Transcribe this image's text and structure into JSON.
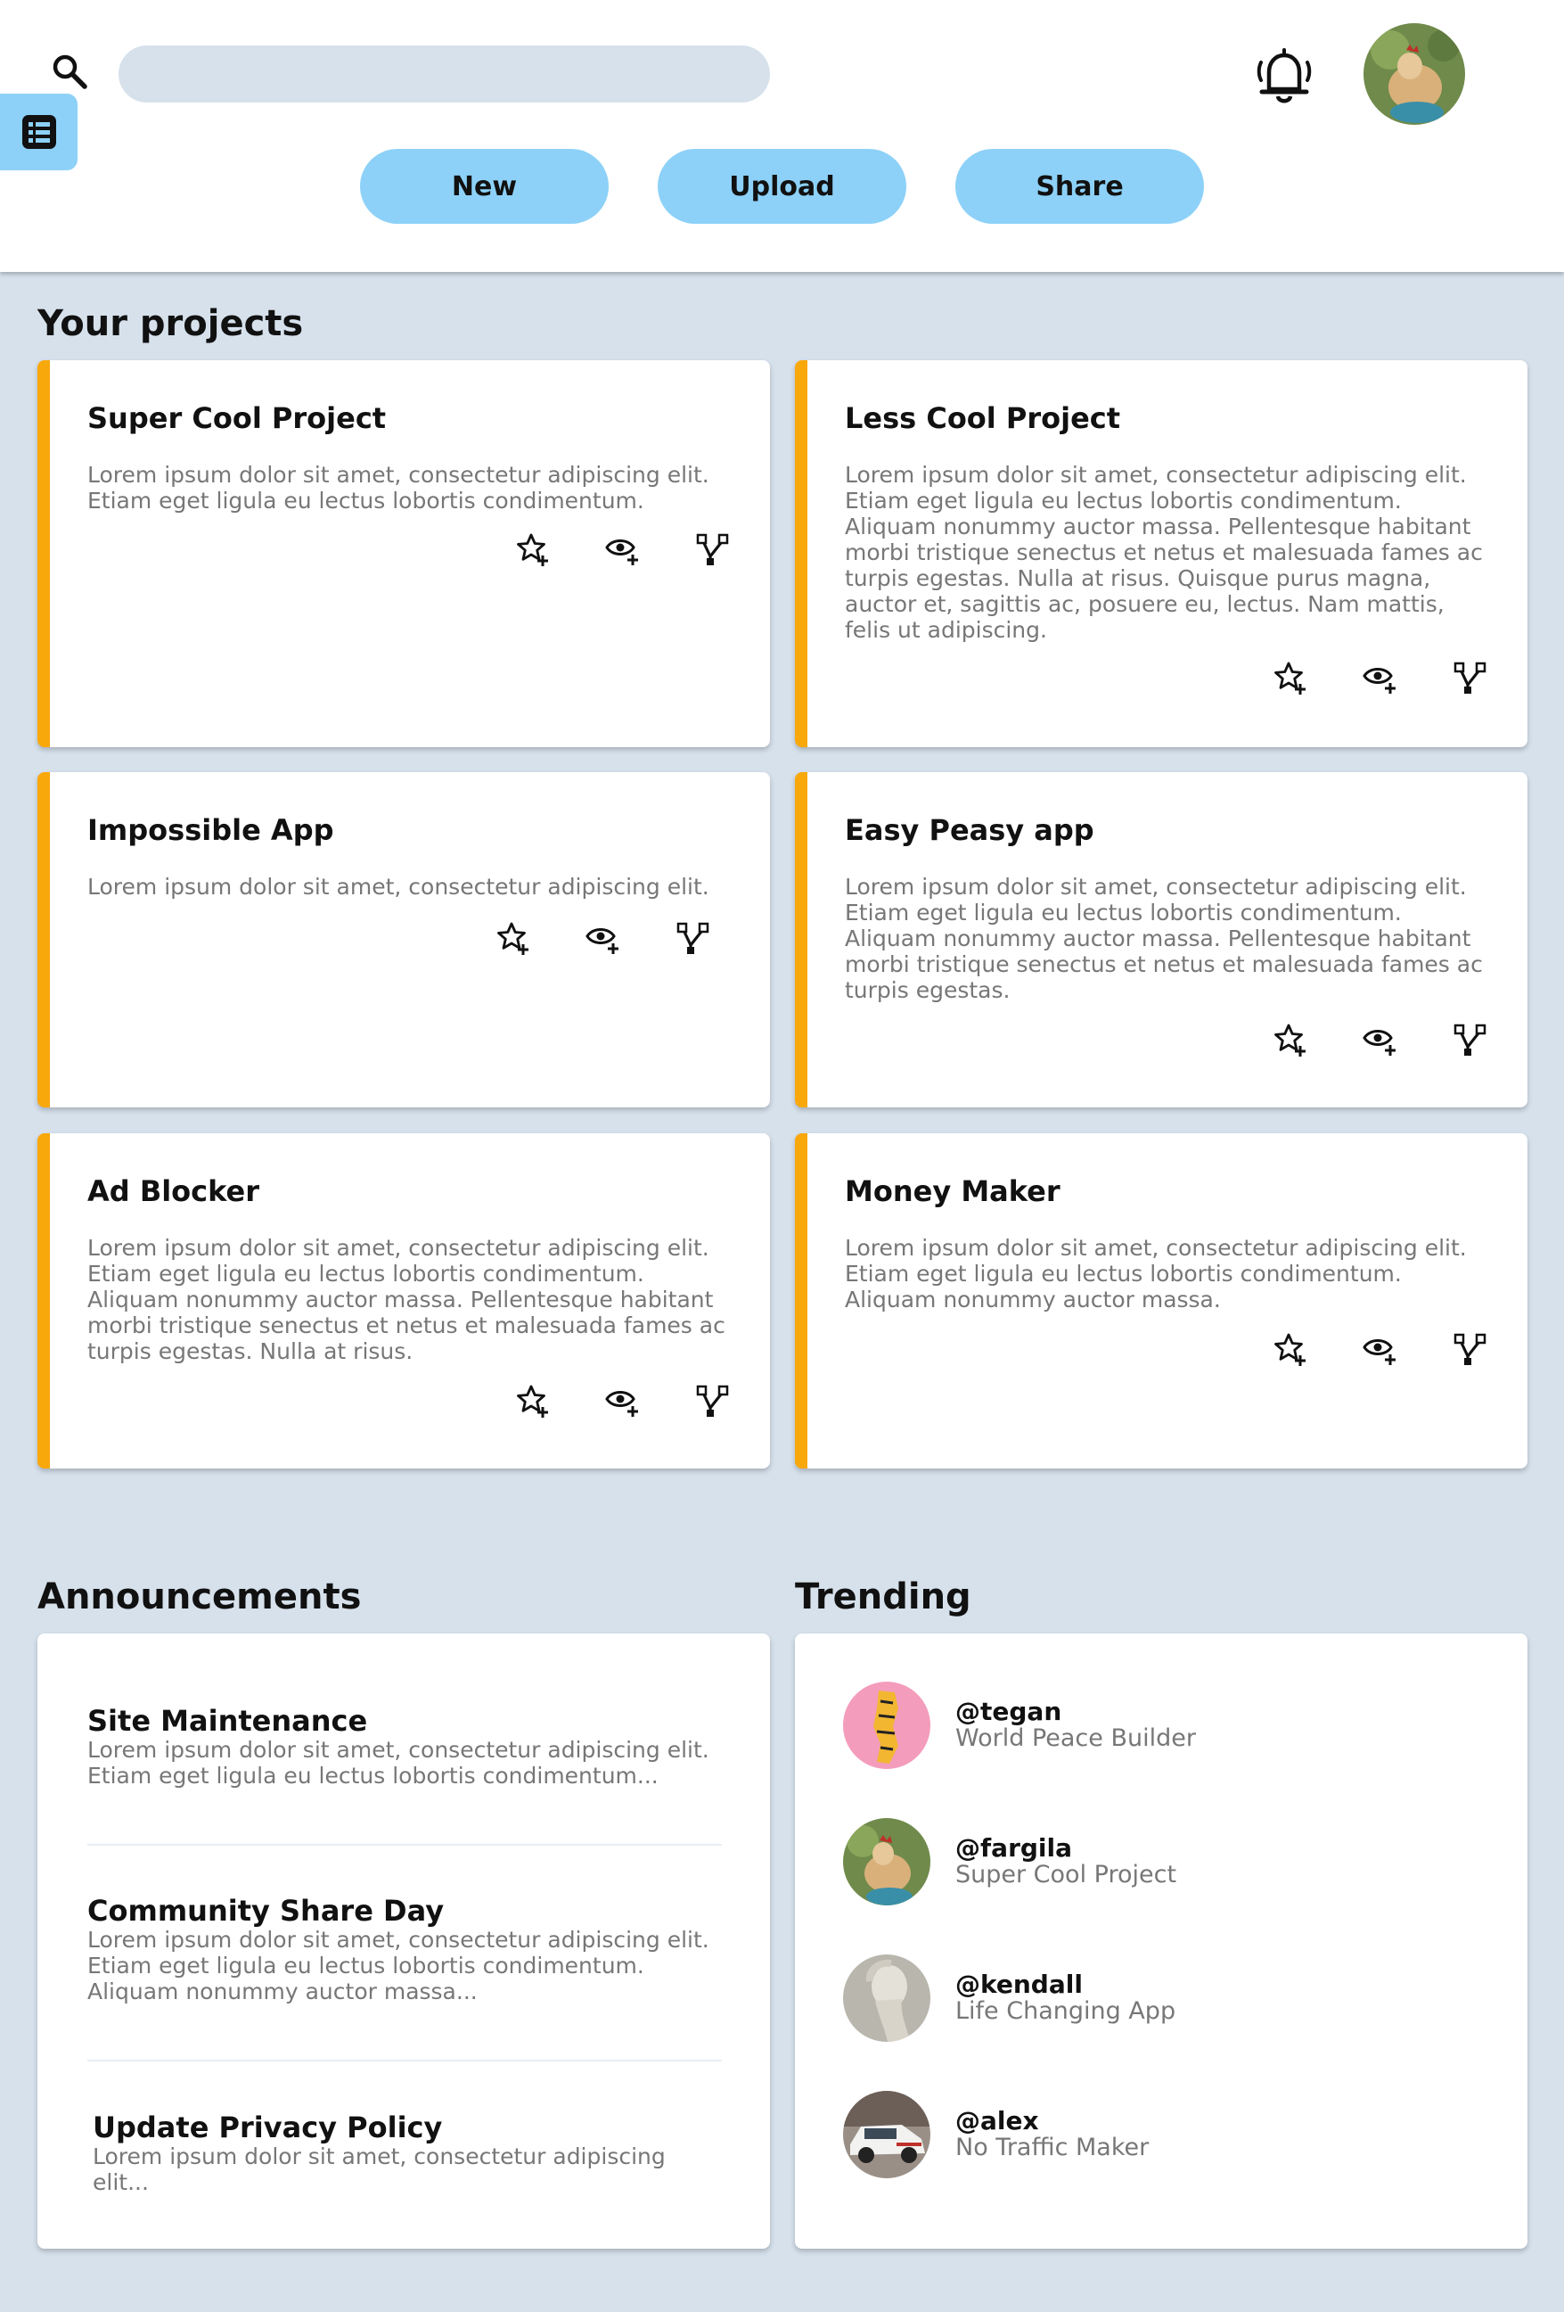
{
  "header": {
    "search": {
      "placeholder": ""
    },
    "actions": {
      "new_label": "New",
      "upload_label": "Upload",
      "share_label": "Share"
    },
    "icons": {
      "search": "search-icon",
      "sidebar": "list-icon",
      "notifications": "bell-icon",
      "avatar": "user-avatar"
    }
  },
  "colors": {
    "accent_blue": "#8dd1f8",
    "card_stripe": "#f9a80c",
    "background": "#d6e1ec"
  },
  "projects": {
    "title": "Your projects",
    "items": [
      {
        "title": "Super Cool Project",
        "description": "Lorem ipsum dolor sit amet, consectetur adipiscing elit. Etiam eget ligula eu lectus lobortis condimentum."
      },
      {
        "title": "Less Cool Project",
        "description": "Lorem ipsum dolor sit amet, consectetur adipiscing elit. Etiam eget ligula eu lectus lobortis condimentum. Aliquam nonummy auctor massa. Pellentesque habitant morbi tristique senectus et netus et malesuada fames ac turpis egestas. Nulla at risus. Quisque purus magna, auctor et, sagittis ac, posuere eu, lectus. Nam mattis, felis ut adipiscing."
      },
      {
        "title": "Impossible App",
        "description": "Lorem ipsum dolor sit amet, consectetur adipiscing elit."
      },
      {
        "title": "Easy Peasy app",
        "description": "Lorem ipsum dolor sit amet, consectetur adipiscing elit. Etiam eget ligula eu lectus lobortis condimentum. Aliquam nonummy auctor massa. Pellentesque habitant morbi tristique senectus et netus et malesuada fames ac turpis egestas."
      },
      {
        "title": "Ad Blocker",
        "description": "Lorem ipsum dolor sit amet, consectetur adipiscing elit. Etiam eget ligula eu lectus lobortis condimentum. Aliquam nonummy auctor massa. Pellentesque habitant morbi tristique senectus et netus et malesuada fames ac turpis egestas. Nulla at risus."
      },
      {
        "title": "Money Maker",
        "description": "Lorem ipsum dolor sit amet, consectetur adipiscing elit. Etiam eget ligula eu lectus lobortis condimentum. Aliquam nonummy auctor massa."
      }
    ],
    "action_icons": [
      "star-plus-icon",
      "eye-plus-icon",
      "fork-icon"
    ]
  },
  "announcements": {
    "title": "Announcements",
    "items": [
      {
        "title": "Site Maintenance",
        "text": "Lorem ipsum dolor sit amet, consectetur adipiscing elit. Etiam eget ligula eu lectus lobortis condimentum..."
      },
      {
        "title": "Community Share Day",
        "text": "Lorem ipsum dolor sit amet, consectetur adipiscing elit. Etiam eget ligula eu lectus lobortis condimentum. Aliquam nonummy auctor massa..."
      },
      {
        "title": "Update Privacy Policy",
        "text": "Lorem ipsum dolor sit amet, consectetur adipiscing elit..."
      }
    ]
  },
  "trending": {
    "title": "Trending",
    "items": [
      {
        "handle": "@tegan",
        "project": "World Peace Builder"
      },
      {
        "handle": "@fargila",
        "project": "Super Cool Project"
      },
      {
        "handle": "@kendall",
        "project": "Life Changing App"
      },
      {
        "handle": "@alex",
        "project": "No Traffic Maker"
      }
    ]
  }
}
